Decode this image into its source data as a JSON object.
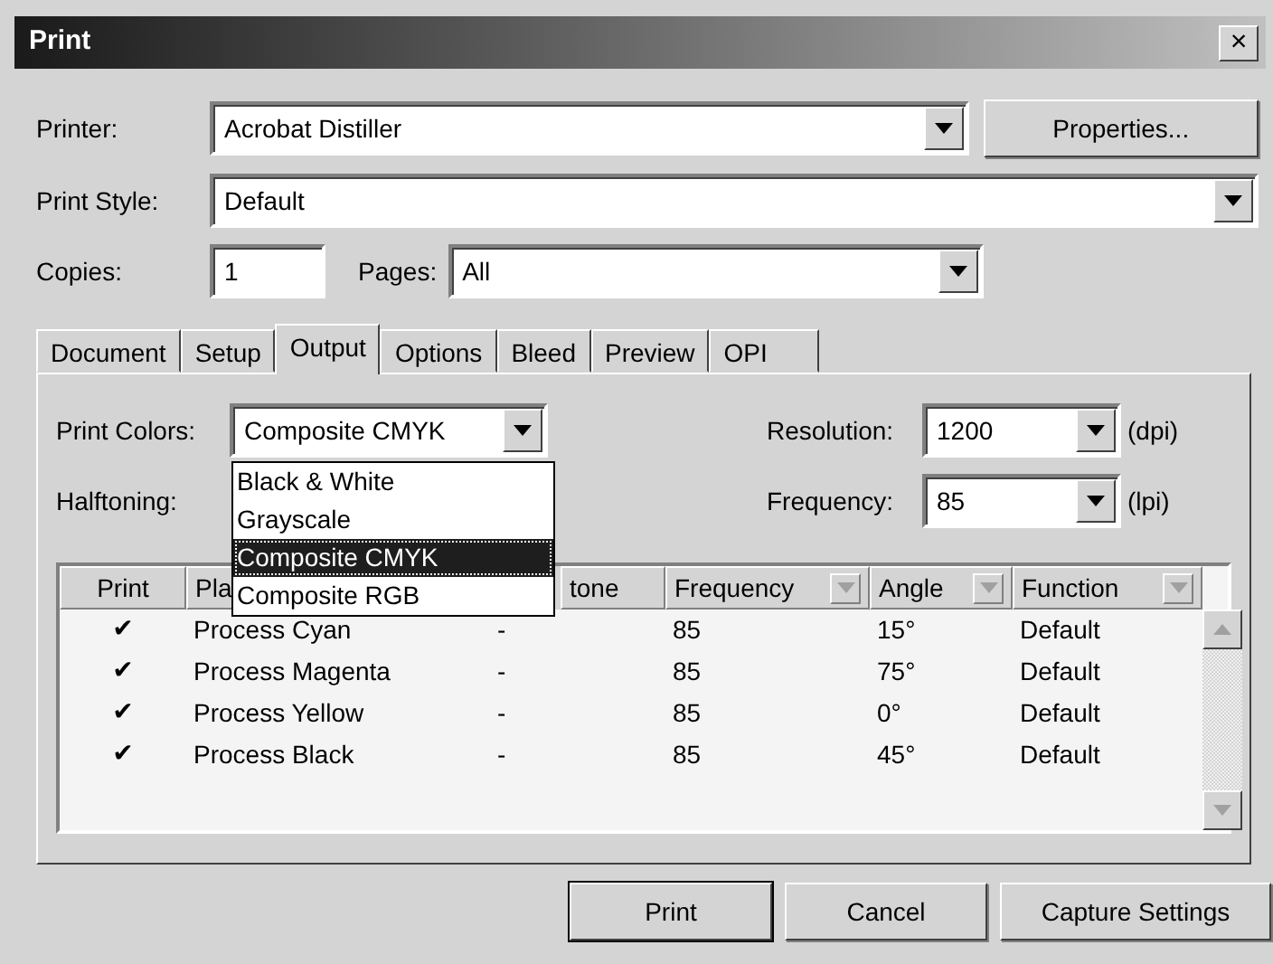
{
  "window": {
    "title": "Print",
    "close": "×"
  },
  "printer": {
    "label": "Printer:",
    "value": "Acrobat Distiller",
    "button": "Properties..."
  },
  "print_style": {
    "label": "Print Style:",
    "value": "Default"
  },
  "copies": {
    "label": "Copies:",
    "value": "1"
  },
  "pages": {
    "label": "Pages:",
    "value": "All"
  },
  "tabs": [
    {
      "label": "Document",
      "selected": false
    },
    {
      "label": "Setup",
      "selected": false
    },
    {
      "label": "Output",
      "selected": true
    },
    {
      "label": "Options",
      "selected": false
    },
    {
      "label": "Bleed",
      "selected": false
    },
    {
      "label": "Preview",
      "selected": false
    },
    {
      "label": "OPI",
      "selected": false
    }
  ],
  "print_colors": {
    "label": "Print Colors:",
    "value": "Composite CMYK",
    "expanded": true,
    "options": [
      {
        "label": "Black & White",
        "selected": false
      },
      {
        "label": "Grayscale",
        "selected": false
      },
      {
        "label": "Composite CMYK",
        "selected": true
      },
      {
        "label": "Composite RGB",
        "selected": false
      }
    ]
  },
  "halftoning": {
    "label": "Halftoning:"
  },
  "resolution": {
    "label": "Resolution:",
    "value": "1200",
    "unit": "(dpi)"
  },
  "frequency": {
    "label": "Frequency:",
    "value": "85",
    "unit": "(lpi)"
  },
  "table": {
    "columns": [
      {
        "label": "Print",
        "sortable": false
      },
      {
        "label": "Pla"
      },
      {
        "label": "tone"
      },
      {
        "label": "Frequency",
        "sortable": true
      },
      {
        "label": "Angle",
        "sortable": true
      },
      {
        "label": "Function",
        "sortable": true
      }
    ],
    "rows": [
      [
        "✔",
        "Process Cyan",
        "-",
        "85",
        "15°",
        "Default"
      ],
      [
        "✔",
        "Process Magenta",
        "-",
        "85",
        "75°",
        "Default"
      ],
      [
        "✔",
        "Process Yellow",
        "-",
        "85",
        "0°",
        "Default"
      ],
      [
        "✔",
        "Process Black",
        "-",
        "85",
        "45°",
        "Default"
      ]
    ]
  },
  "buttons": [
    {
      "label": "Print",
      "default": true
    },
    {
      "label": "Cancel",
      "default": false
    },
    {
      "label": "Capture Settings",
      "default": false
    }
  ]
}
